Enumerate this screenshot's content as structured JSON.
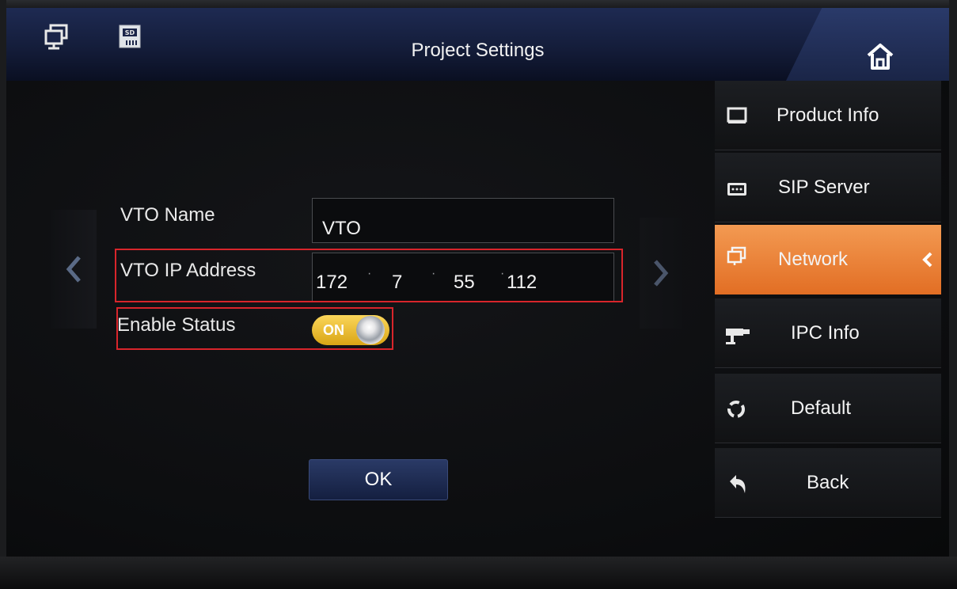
{
  "header": {
    "title": "Project Settings",
    "left_icons": [
      "multi-screen-icon",
      "sd-card-icon"
    ],
    "home_icon": "home-icon"
  },
  "form": {
    "vto_name_label": "VTO Name",
    "vto_name_value": "VTO",
    "vto_ip_label": "VTO IP Address",
    "ip_segments": [
      "172",
      "7",
      "55",
      "112"
    ],
    "enable_status_label": "Enable Status",
    "toggle_label": "ON",
    "toggle_on": true
  },
  "ok_label": "OK",
  "sidebar": {
    "items": [
      {
        "label": "Product Info",
        "icon": "monitor-icon",
        "active": false
      },
      {
        "label": "SIP Server",
        "icon": "server-icon",
        "active": false
      },
      {
        "label": "Network",
        "icon": "network-icon",
        "active": true
      },
      {
        "label": "IPC Info",
        "icon": "camera-icon",
        "active": false
      },
      {
        "label": "Default",
        "icon": "recycle-icon",
        "active": false
      },
      {
        "label": "Back",
        "icon": "back-arrow-icon",
        "active": false
      }
    ]
  },
  "colors": {
    "accent": "#ee8a3f",
    "header": "#1c2850",
    "highlight_box": "#d8252b",
    "toggle": "#f0c030"
  }
}
